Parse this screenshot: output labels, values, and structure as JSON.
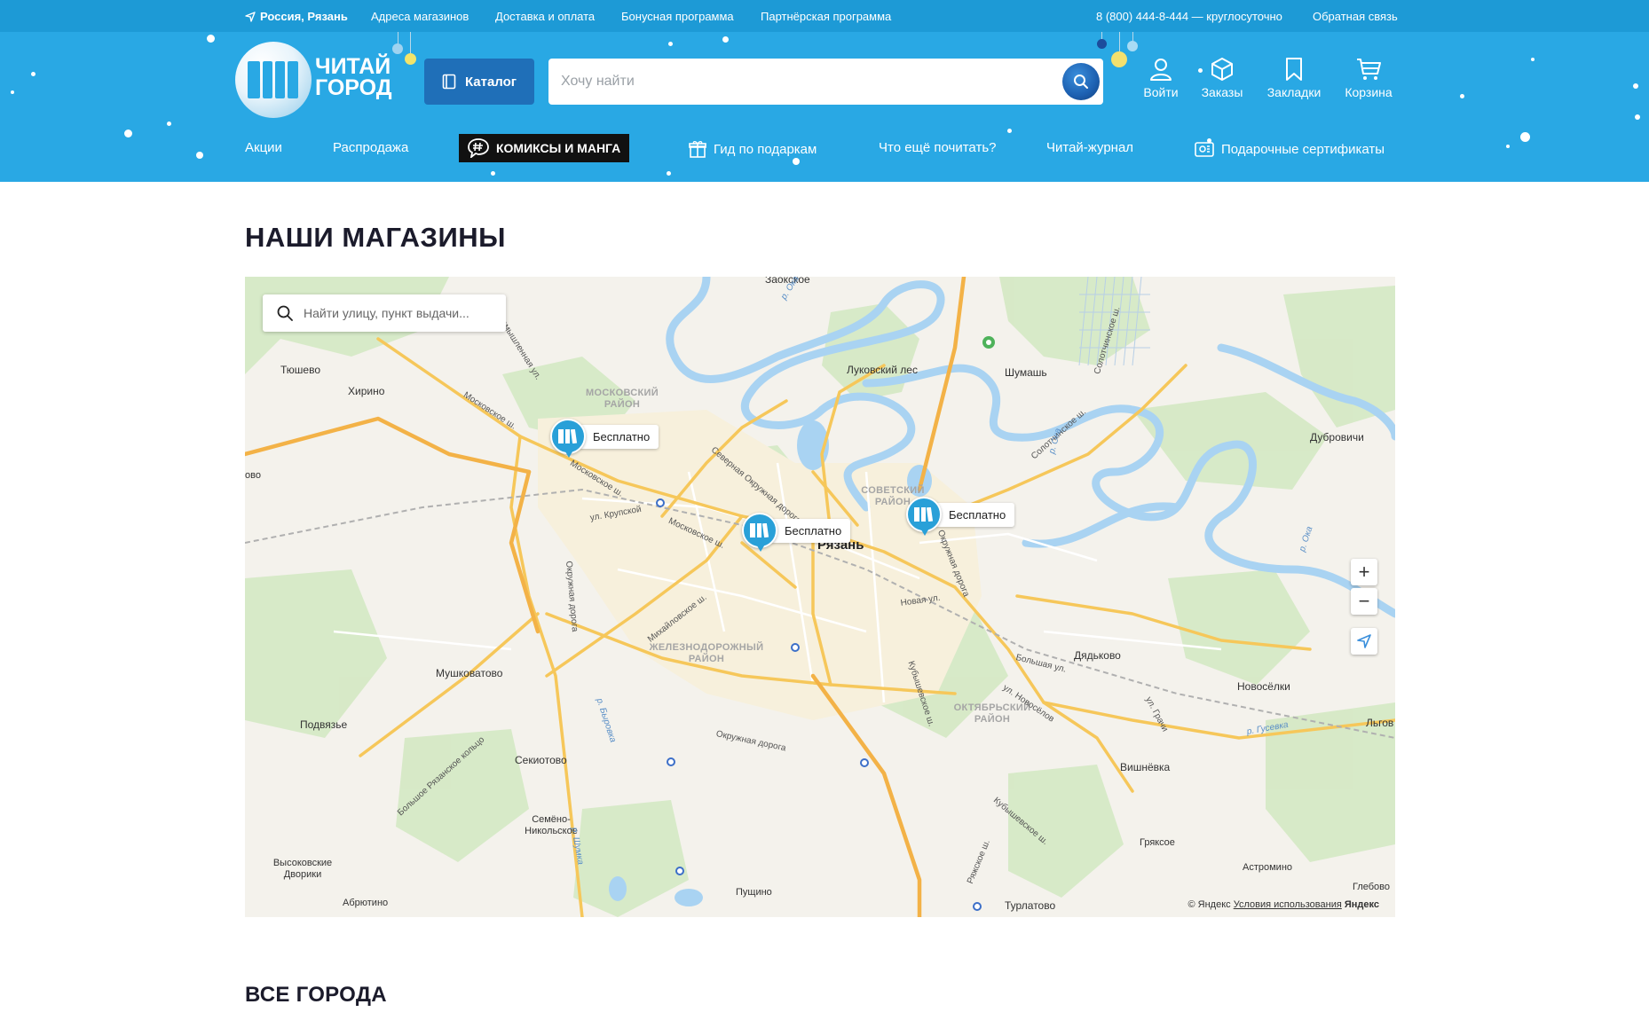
{
  "topbar": {
    "location": "Россия, Рязань",
    "links": [
      "Адреса магазинов",
      "Доставка и оплата",
      "Бонусная программа",
      "Партнёрская программа"
    ],
    "phone": "8 (800) 444-8-444 — круглосуточно",
    "feedback": "Обратная связь"
  },
  "header": {
    "logo_line1": "ЧИТАЙ",
    "logo_line2": "ГОРОД",
    "catalog_label": "Каталог",
    "search_placeholder": "Хочу найти",
    "icons": [
      {
        "label": "Войти",
        "icon": "user-icon"
      },
      {
        "label": "Заказы",
        "icon": "box-icon"
      },
      {
        "label": "Закладки",
        "icon": "bookmark-icon"
      },
      {
        "label": "Корзина",
        "icon": "cart-icon"
      }
    ],
    "nav": [
      "Акции",
      "Распродажа",
      "КОМИКСЫ И МАНГА",
      "Гид по подаркам",
      "Что ещё почитать?",
      "Читай-журнал",
      "Подарочные сертификаты"
    ]
  },
  "page": {
    "title": "НАШИ МАГАЗИНЫ",
    "cities_title": "ВСЕ ГОРОДА"
  },
  "map": {
    "search_placeholder": "Найти улицу, пункт выдачи...",
    "pins": [
      "Бесплатно",
      "Бесплатно",
      "Бесплатно"
    ],
    "city": "Рязань",
    "places": [
      "Заокское",
      "Луковский лес",
      "Шумашь",
      "Тюшево",
      "Хирино",
      "Дубровичи",
      "Дядьково",
      "Новосёлки",
      "Мушковатово",
      "Подвязье",
      "Секиотово",
      "Семёно-Никольское",
      "Высоковские Дворики",
      "Абрютино",
      "Пущино",
      "Турлатово",
      "Вишнёвка",
      "Грякcое",
      "Астромино",
      "Глебово",
      "Льгов",
      "ово"
    ],
    "districts": [
      "МОСКОВСКИЙ РАЙОН",
      "СОВЕТСКИЙ РАЙОН",
      "ЖЕЛЕЗНОДОРОЖНЫЙ РАЙОН",
      "ОКТЯБРЬСКИЙ РАЙОН"
    ],
    "roads": [
      "Промышленная ул.",
      "Московское ш.",
      "Московское ш.",
      "Московское ш.",
      "ул. Крупской",
      "Северная Окружная дорога",
      "Окружная дорога",
      "Михайловское ш.",
      "Окружная дорога",
      "Большое Рязанское кольцо",
      "Новая ул.",
      "Окружная дорога",
      "Кубышевское ш.",
      "Кубышевское ш.",
      "Ряжское ш.",
      "Солотчинское ш.",
      "Солотчинское ш.",
      "Большая ул.",
      "ул. Новосёлов",
      "ул. Грачи"
    ],
    "rivers": [
      "р. Ока",
      "р. Ока",
      "р. Ока",
      "р. Гусевка",
      "р. Шумка",
      "р. Быровка"
    ],
    "copyright_prefix": "© Яндекс",
    "terms": "Условия использования",
    "yandex": "Яндекс"
  },
  "colors": {
    "topbar": "#1d9ad6",
    "header": "#29a8e4",
    "catalog": "#1f6fb8",
    "pin": "#29a0d8"
  }
}
